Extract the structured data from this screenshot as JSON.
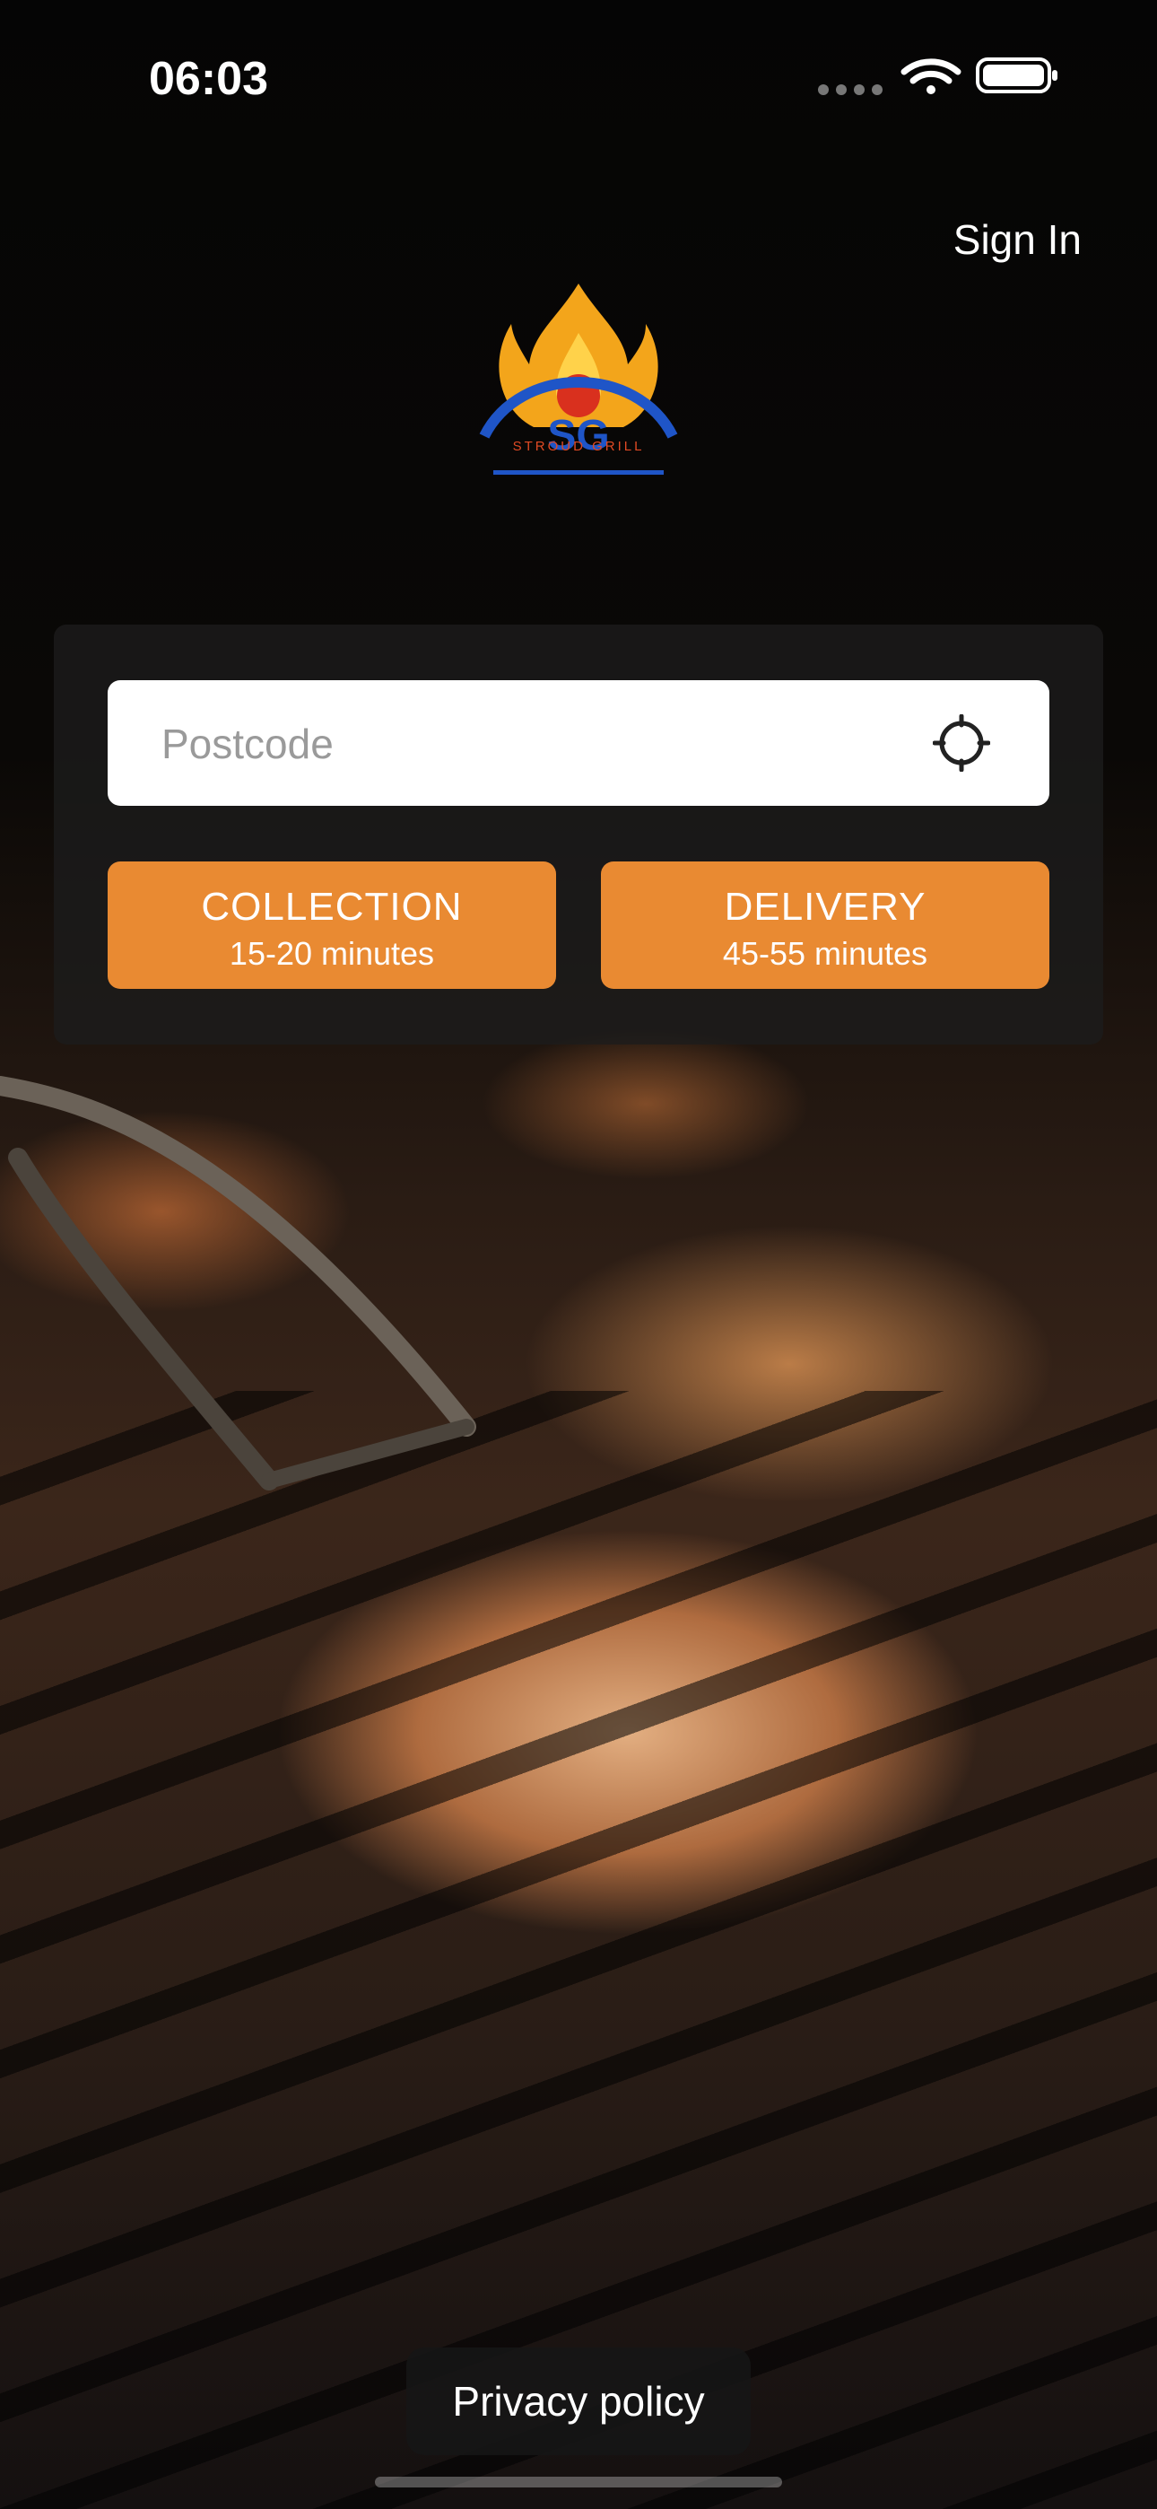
{
  "status_bar": {
    "time": "06:03",
    "icons": [
      "signal-icon",
      "wifi-icon",
      "battery-icon"
    ]
  },
  "header": {
    "sign_in_label": "Sign In"
  },
  "brand": {
    "logo_text": "STROUD GRILL",
    "logo_monogram": "SG"
  },
  "order_card": {
    "postcode_placeholder": "Postcode",
    "postcode_value": "",
    "locate_icon": "crosshair-icon",
    "collection": {
      "label": "COLLECTION",
      "time": "15-20 minutes"
    },
    "delivery": {
      "label": "DELIVERY",
      "time": "45-55 minutes"
    }
  },
  "footer": {
    "privacy_label": "Privacy policy"
  },
  "colors": {
    "accent": "#e98a32",
    "card_bg": "#1c1c1c",
    "text": "#ffffff"
  }
}
